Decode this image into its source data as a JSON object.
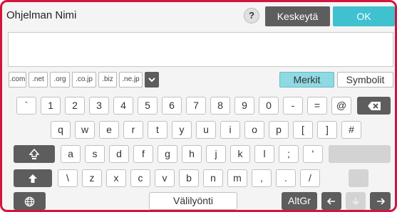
{
  "header": {
    "title": "Ohjelman Nimi",
    "help_label": "?",
    "cancel_label": "Keskeytä",
    "ok_label": "OK"
  },
  "input": {
    "value": ""
  },
  "domains": [
    ".com",
    ".net",
    ".org",
    ".co.jp",
    ".biz",
    ".ne.jp"
  ],
  "modes": {
    "merkit": "Merkit",
    "symbolit": "Symbolit"
  },
  "keyboard": {
    "row1": [
      "`",
      "1",
      "2",
      "3",
      "4",
      "5",
      "6",
      "7",
      "8",
      "9",
      "0",
      "-",
      "=",
      "@"
    ],
    "row2": [
      "q",
      "w",
      "e",
      "r",
      "t",
      "y",
      "u",
      "i",
      "o",
      "p",
      "[",
      "]",
      "#"
    ],
    "row3": [
      "a",
      "s",
      "d",
      "f",
      "g",
      "h",
      "j",
      "k",
      "l",
      ";",
      "'"
    ],
    "row4": [
      "\\",
      "z",
      "x",
      "c",
      "v",
      "b",
      "n",
      "m",
      ",",
      ".",
      "/"
    ],
    "space_label": "Välilyönti",
    "altgr_label": "AltGr"
  },
  "icons": {
    "backspace": "backspace-icon",
    "caps_lock": "caps-lock-icon",
    "shift": "shift-icon",
    "globe": "globe-icon",
    "expand": "chevron-down-icon",
    "left": "arrow-left-icon",
    "down": "arrow-down-icon",
    "right": "arrow-right-icon"
  },
  "colors": {
    "frame": "#d2153c",
    "accent": "#3fc1d0",
    "active_mode": "#8fd9e3",
    "dark_key": "#5d5d5d"
  }
}
